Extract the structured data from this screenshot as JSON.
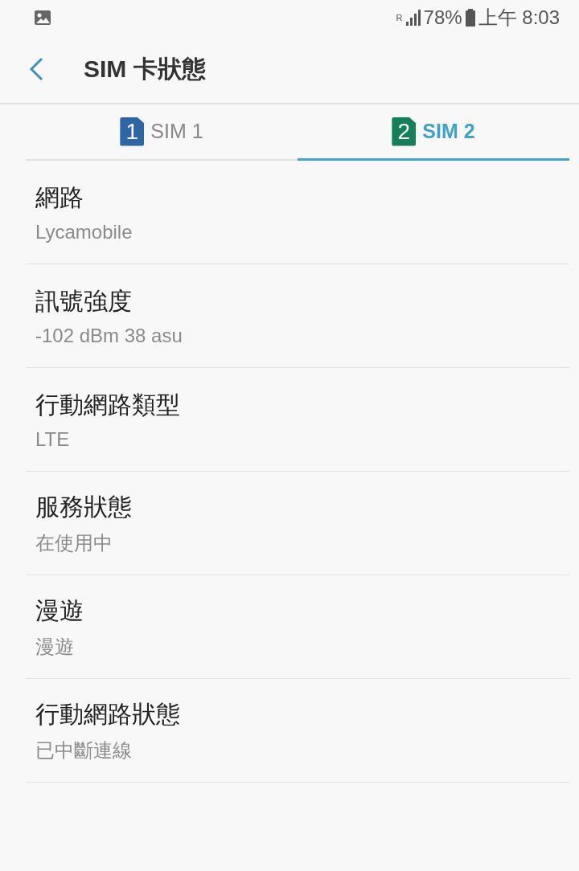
{
  "status_bar": {
    "roaming": "R",
    "battery": "78%",
    "time": "上午 8:03"
  },
  "header": {
    "title": "SIM 卡狀態"
  },
  "tabs": [
    {
      "number": "1",
      "label": "SIM 1",
      "color": "#2d65a5",
      "selected": false
    },
    {
      "number": "2",
      "label": "SIM 2",
      "color": "#14805a",
      "selected": true
    }
  ],
  "items": [
    {
      "title": "網路",
      "value": "Lycamobile"
    },
    {
      "title": "訊號強度",
      "value": "-102 dBm 38 asu"
    },
    {
      "title": "行動網路類型",
      "value": "LTE"
    },
    {
      "title": "服務狀態",
      "value": "在使用中"
    },
    {
      "title": "漫遊",
      "value": "漫遊"
    },
    {
      "title": "行動網路狀態",
      "value": "已中斷連線"
    }
  ]
}
